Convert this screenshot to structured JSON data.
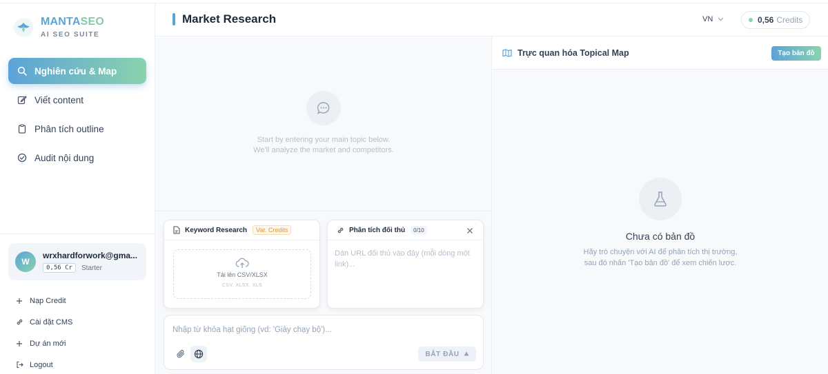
{
  "brand": {
    "name_part1": "MANTA",
    "name_part2": "SEO",
    "subtitle": "AI SEO SUITE"
  },
  "nav": {
    "items": [
      {
        "label": "Nghiên cứu & Map",
        "icon": "search-icon",
        "active": true
      },
      {
        "label": "Viết content",
        "icon": "edit-icon"
      },
      {
        "label": "Phân tích outline",
        "icon": "clipboard-icon"
      },
      {
        "label": "Audit nội dung",
        "icon": "check-circle-icon"
      }
    ]
  },
  "user": {
    "initial": "W",
    "email": "wrxhardforwork@gma...",
    "credits": "0,56 Cr",
    "plan": "Starter"
  },
  "side_links": [
    {
      "label": "Nạp Credit",
      "icon": "plus-icon"
    },
    {
      "label": "Cài đặt CMS",
      "icon": "link-icon"
    },
    {
      "label": "Dự án mới",
      "icon": "plus-icon"
    },
    {
      "label": "Logout",
      "icon": "logout-icon"
    }
  ],
  "header": {
    "title": "Market Research",
    "language": "VN",
    "credits_value": "0,56",
    "credits_label": "Credits"
  },
  "chat": {
    "empty_line1": "Start by entering your main topic below.",
    "empty_line2": "We'll analyze the market and competitors."
  },
  "keyword_card": {
    "title": "Keyword Research",
    "tag": "Var. Credits",
    "upload_label": "Tải lên CSV/XLSX",
    "upload_formats": "CSV, XLSX, XLS"
  },
  "competitor_card": {
    "title": "Phân tích đối thủ",
    "count": "0/10",
    "placeholder": "Dán URL đối thủ vào đây (mỗi dòng một link)..."
  },
  "composer": {
    "placeholder": "Nhập từ khóa hạt giống (vd: 'Giày chạy bộ')...",
    "start_label": "BẮT ĐẦU"
  },
  "map_panel": {
    "title": "Trực quan hóa Topical Map",
    "create_label": "Tạo bản đồ",
    "empty_title": "Chưa có bản đồ",
    "empty_desc1": "Hãy trò chuyện với AI để phân tích thị trường,",
    "empty_desc2": "sau đó nhấn 'Tạo bản đồ' để xem chiến lược."
  },
  "colors": {
    "accent_blue": "#5aa5d6",
    "accent_green": "#8ad3ad",
    "warning": "#d59a3c"
  }
}
